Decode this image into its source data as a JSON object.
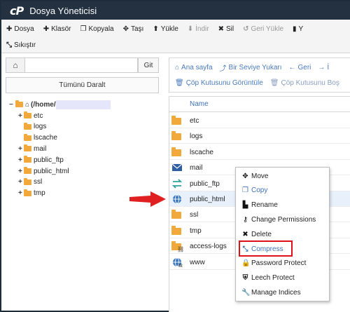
{
  "app": {
    "logo": "cP",
    "title": "Dosya Yöneticisi"
  },
  "toolbar": {
    "row1": [
      {
        "icon": "plus-icon",
        "glyph": "✚",
        "label": "Dosya",
        "disabled": false
      },
      {
        "icon": "plus-icon",
        "glyph": "✚",
        "label": "Klasör",
        "disabled": false
      },
      {
        "icon": "copy-icon",
        "glyph": "❐",
        "label": "Kopyala",
        "disabled": false
      },
      {
        "icon": "move-icon",
        "glyph": "✥",
        "label": "Taşı",
        "disabled": false
      },
      {
        "icon": "upload-icon",
        "glyph": "⬆",
        "label": "Yükle",
        "disabled": false
      },
      {
        "icon": "download-icon",
        "glyph": "⬇",
        "label": "İndir",
        "disabled": true
      },
      {
        "icon": "delete-icon",
        "glyph": "✖",
        "label": "Sil",
        "disabled": false
      },
      {
        "icon": "undo-icon",
        "glyph": "↺",
        "label": "Geri Yükle",
        "disabled": true
      },
      {
        "icon": "file-icon",
        "glyph": "▮",
        "label": "Y",
        "disabled": false
      }
    ],
    "row2": [
      {
        "icon": "compress-icon",
        "glyph": "⤡",
        "label": "Sıkıştır",
        "disabled": false
      }
    ]
  },
  "left": {
    "path_value": "",
    "go_label": "Git",
    "collapse_label": "Tümünü Daralt",
    "root_label": "(/home/",
    "tree": [
      {
        "label": "etc",
        "expandable": true
      },
      {
        "label": "logs",
        "expandable": false
      },
      {
        "label": "lscache",
        "expandable": false
      },
      {
        "label": "mail",
        "expandable": true
      },
      {
        "label": "public_ftp",
        "expandable": true
      },
      {
        "label": "public_html",
        "expandable": true
      },
      {
        "label": "ssl",
        "expandable": true
      },
      {
        "label": "tmp",
        "expandable": true
      }
    ]
  },
  "nav": {
    "row1": [
      {
        "icon": "home-icon",
        "glyph": "⌂",
        "label": "Ana sayfa"
      },
      {
        "icon": "level-up-icon",
        "glyph": "⤴",
        "label": "Bir Seviye Yukarı"
      },
      {
        "icon": "back-arrow-icon",
        "glyph": "←",
        "label": "Geri"
      },
      {
        "icon": "forward-arrow-icon",
        "glyph": "→",
        "label": "İ"
      }
    ],
    "row2": [
      {
        "icon": "trash-icon",
        "glyph": "🗑",
        "label": "Çöp Kutusunu Görüntüle",
        "disabled": false
      },
      {
        "icon": "trash-icon",
        "glyph": "🗑",
        "label": "Çöp Kutusunu Boş",
        "disabled": true
      }
    ]
  },
  "list": {
    "header_name": "Name",
    "rows": [
      {
        "name": "etc",
        "type": "folder"
      },
      {
        "name": "logs",
        "type": "folder"
      },
      {
        "name": "lscache",
        "type": "folder"
      },
      {
        "name": "mail",
        "type": "mail"
      },
      {
        "name": "public_ftp",
        "type": "ftp"
      },
      {
        "name": "public_html",
        "type": "web",
        "highlighted": true
      },
      {
        "name": "ssl",
        "type": "folder"
      },
      {
        "name": "tmp",
        "type": "folder"
      },
      {
        "name": "access-logs",
        "type": "folder-link"
      },
      {
        "name": "www",
        "type": "web-link"
      }
    ]
  },
  "context_menu": {
    "items": [
      {
        "icon": "move-icon",
        "glyph": "✥",
        "label": "Move",
        "style": "normal"
      },
      {
        "icon": "copy-icon",
        "glyph": "❐",
        "label": "Copy",
        "style": "blue"
      },
      {
        "icon": "rename-icon",
        "glyph": "▙",
        "label": "Rename",
        "style": "normal"
      },
      {
        "icon": "key-icon",
        "glyph": "⚷",
        "label": "Change Permissions",
        "style": "normal"
      },
      {
        "icon": "delete-icon",
        "glyph": "✖",
        "label": "Delete",
        "style": "normal"
      },
      {
        "icon": "compress-icon",
        "glyph": "⤡",
        "label": "Compress",
        "style": "blue",
        "boxed": true
      },
      {
        "icon": "lock-icon",
        "glyph": "🔒",
        "label": "Password Protect",
        "style": "normal"
      },
      {
        "icon": "shield-icon",
        "glyph": "⛨",
        "label": "Leech Protect",
        "style": "normal"
      },
      {
        "icon": "wrench-icon",
        "glyph": "🔧",
        "label": "Manage Indices",
        "style": "normal"
      }
    ]
  },
  "colors": {
    "titlebar": "#233140",
    "link_blue": "#3f72b7",
    "folder": "#f2a93b",
    "highlight_red": "#e0101a",
    "arrow_red": "#e02020"
  }
}
